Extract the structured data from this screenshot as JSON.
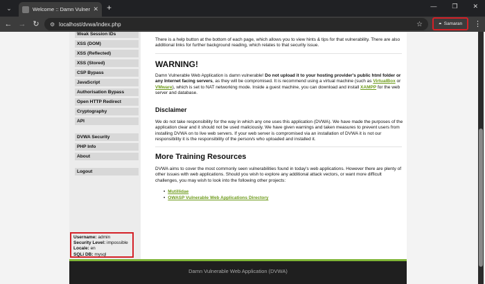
{
  "browser": {
    "tab_title": "Welcome :: Damn Vulnerable Web Application (DVWA)",
    "url": "localhost/dvwa/index.php",
    "profile_name": "Samaran",
    "icons": {
      "tab_list": "chevron-down-icon",
      "new_tab": "plus-icon",
      "back": "arrow-left-icon",
      "forward": "arrow-right-icon",
      "reload": "reload-icon",
      "site_info": "site-info-icon",
      "bookmark": "star-icon",
      "incognito": "incognito-icon",
      "menu": "more-vert-icon"
    }
  },
  "sidebar": {
    "items": [
      {
        "label": "Weak Session IDs"
      },
      {
        "label": "XSS (DOM)"
      },
      {
        "label": "XSS (Reflected)"
      },
      {
        "label": "XSS (Stored)"
      },
      {
        "label": "CSP Bypass"
      },
      {
        "label": "JavaScript"
      },
      {
        "label": "Authorisation Bypass"
      },
      {
        "label": "Open HTTP Redirect"
      },
      {
        "label": "Cryptography"
      },
      {
        "label": "API"
      },
      {
        "label": "DVWA Security"
      },
      {
        "label": "PHP Info"
      },
      {
        "label": "About"
      },
      {
        "label": "Logout"
      }
    ]
  },
  "main": {
    "intro_text": "There is a help button at the bottom of each page, which allows you to view hints & tips for that vulnerability. There are also additional links for further background reading, which relates to that security issue.",
    "warning_heading": "WARNING!",
    "warning_p1": "Damn Vulnerable Web Application is damn vulnerable! ",
    "warning_bold": "Do not upload it to your hosting provider's public html folder or any Internet facing servers",
    "warning_p2": ", as they will be compromised. It is recommend using a virtual machine (such as ",
    "link_virtualbox": "VirtualBox",
    "warning_or": " or ",
    "link_vmware": "VMware",
    "warning_p3": "), which is set to NAT networking mode. Inside a guest machine, you can download and install ",
    "link_xampp": "XAMPP",
    "warning_p4": " for the web server and database.",
    "disclaimer_heading": "Disclaimer",
    "disclaimer_text": "We do not take responsibility for the way in which any one uses this application (DVWA). We have made the purposes of the application clear and it should not be used maliciously. We have given warnings and taken measures to prevent users from installing DVWA on to live web servers. If your web server is compromised via an installation of DVWA it is not our responsibility it is the responsibility of the person/s who uploaded and installed it.",
    "training_heading": "More Training Resources",
    "training_text": "DVWA aims to cover the most commonly seen vulnerabilities found in today's web applications. However there are plenty of other issues with web applications. Should you wish to explore any additional attack vectors, or want more difficult challenges, you may wish to look into the following other projects:",
    "resources": [
      {
        "label": "Mutillidae"
      },
      {
        "label": "OWASP Vulnerable Web Applications Directory"
      }
    ]
  },
  "status": {
    "username_label": "Username:",
    "username_value": " admin",
    "security_label": "Security Level:",
    "security_value": " impossible",
    "locale_label": "Locale:",
    "locale_value": " en",
    "sqli_label": "SQLi DB:",
    "sqli_value": " mysql"
  },
  "footer": {
    "text": "Damn Vulnerable Web Application (DVWA)"
  },
  "colors": {
    "accent_green": "#7fb537",
    "link_green": "#6c9a19",
    "highlight_red": "#d42027",
    "footer_bg": "#1f1f1f"
  }
}
